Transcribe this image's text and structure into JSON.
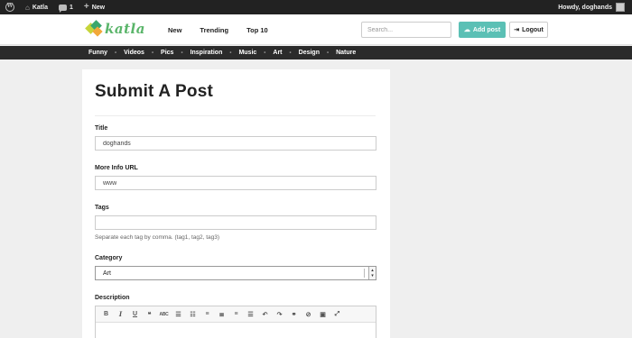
{
  "adminbar": {
    "site_name": "Katla",
    "comments_count": "1",
    "new_label": "New",
    "greeting": "Howdy, doghands"
  },
  "header": {
    "logo_text": "katla",
    "nav": [
      "New",
      "Trending",
      "Top 10"
    ],
    "search_placeholder": "Search...",
    "add_post_label": "Add post",
    "logout_label": "Logout",
    "accent_color": "#5bc0b5"
  },
  "categories": [
    "Funny",
    "Videos",
    "Pics",
    "Inspiration",
    "Music",
    "Art",
    "Design",
    "Nature"
  ],
  "form": {
    "page_title": "Submit A Post",
    "title_label": "Title",
    "title_value": "doghands",
    "url_label": "More Info URL",
    "url_value": "www",
    "tags_label": "Tags",
    "tags_value": "",
    "tags_help": "Separate each tag by comma. (tag1, tag2, tag3)",
    "category_label": "Category",
    "category_value": "Art",
    "description_label": "Description"
  },
  "editor_toolbar": {
    "bold": "B",
    "italic": "I",
    "underline": "U",
    "strike": "ABC"
  }
}
